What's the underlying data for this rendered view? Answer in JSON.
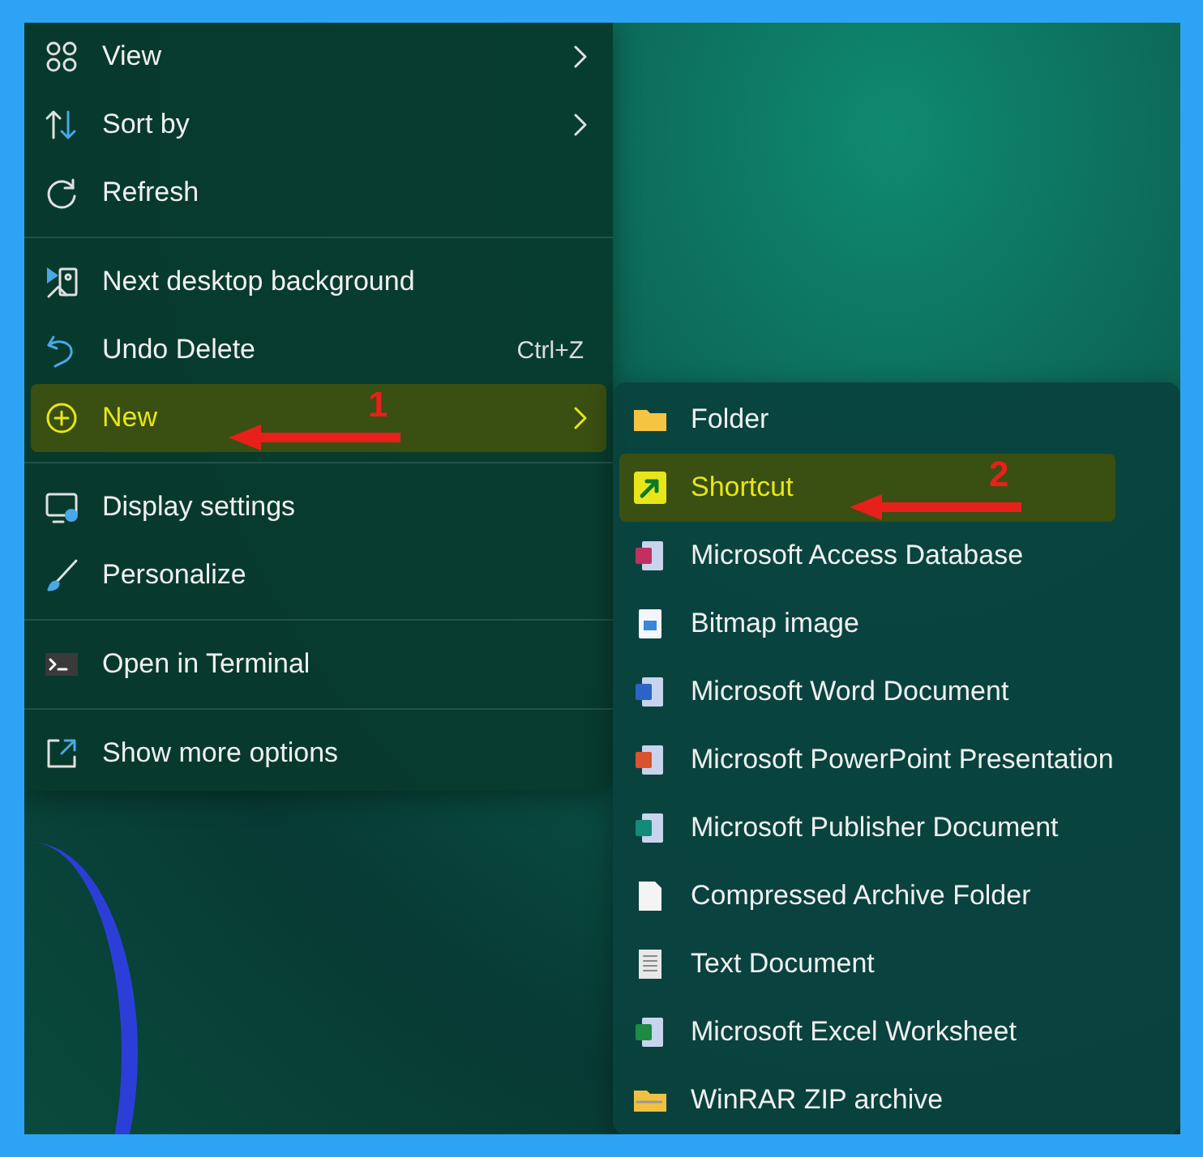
{
  "context_menu": {
    "groups": [
      {
        "items": [
          {
            "label": "View",
            "submenu": true,
            "selected": false
          },
          {
            "label": "Sort by",
            "submenu": true,
            "selected": false
          },
          {
            "label": "Refresh",
            "submenu": false,
            "selected": false
          }
        ]
      },
      {
        "items": [
          {
            "label": "Next desktop background",
            "submenu": false,
            "selected": false
          },
          {
            "label": "Undo Delete",
            "shortcut": "Ctrl+Z",
            "submenu": false,
            "selected": false
          },
          {
            "label": "New",
            "submenu": true,
            "selected": true,
            "annotation": "1"
          }
        ]
      },
      {
        "items": [
          {
            "label": "Display settings",
            "submenu": false,
            "selected": false
          },
          {
            "label": "Personalize",
            "submenu": false,
            "selected": false
          }
        ]
      },
      {
        "items": [
          {
            "label": "Open in Terminal",
            "submenu": false,
            "selected": false
          }
        ]
      },
      {
        "items": [
          {
            "label": "Show more options",
            "submenu": false,
            "selected": false
          }
        ]
      }
    ]
  },
  "new_submenu": {
    "items": [
      {
        "label": "Folder",
        "selected": false
      },
      {
        "label": "Shortcut",
        "selected": true,
        "annotation": "2"
      },
      {
        "label": "Microsoft Access Database",
        "selected": false
      },
      {
        "label": "Bitmap image",
        "selected": false
      },
      {
        "label": "Microsoft Word Document",
        "selected": false
      },
      {
        "label": "Microsoft PowerPoint Presentation",
        "selected": false
      },
      {
        "label": "Microsoft Publisher Document",
        "selected": false
      },
      {
        "label": "Compressed Archive Folder",
        "selected": false
      },
      {
        "label": "Text Document",
        "selected": false
      },
      {
        "label": "Microsoft Excel Worksheet",
        "selected": false
      },
      {
        "label": "WinRAR ZIP archive",
        "selected": false
      }
    ]
  }
}
